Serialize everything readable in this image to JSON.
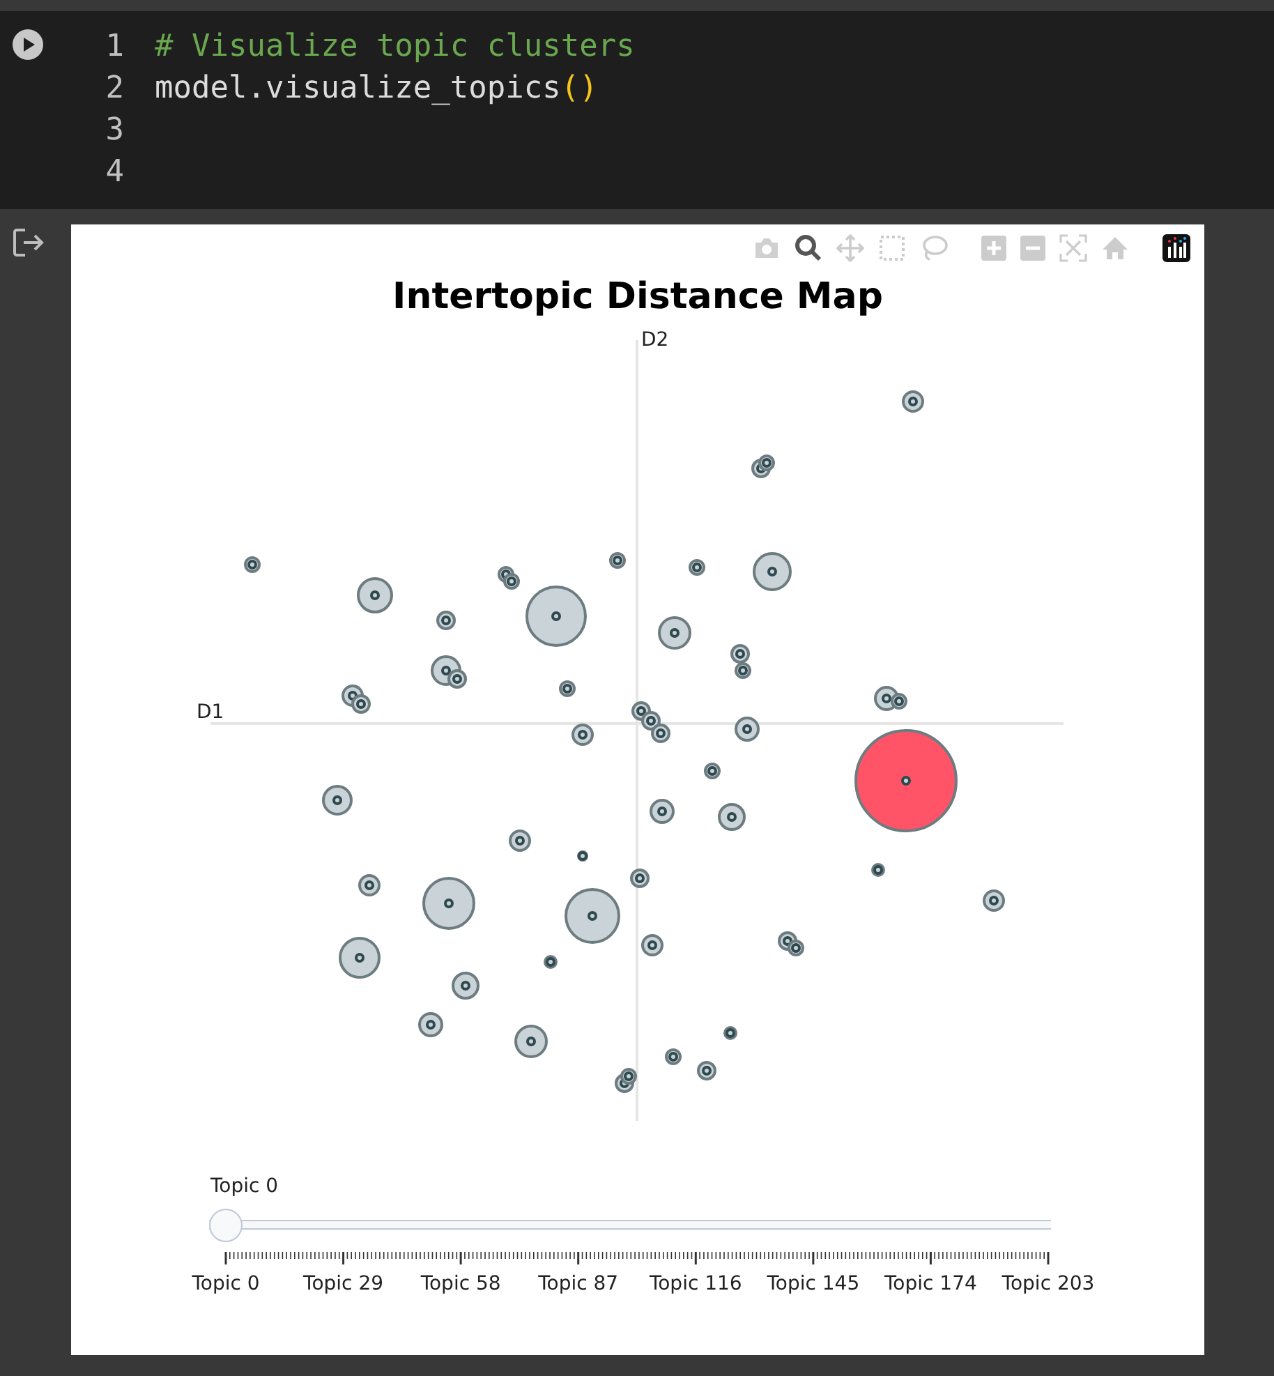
{
  "code_cell": {
    "lines": [
      {
        "number": "1",
        "kind": "comment",
        "text": "# Visualize topic clusters"
      },
      {
        "number": "2",
        "kind": "call",
        "text": "model.visualize_topics",
        "parens": "()"
      },
      {
        "number": "3",
        "kind": "blank"
      },
      {
        "number": "4",
        "kind": "blank"
      }
    ]
  },
  "chart": {
    "title": "Intertopic Distance Map",
    "x_axis_label": "D1",
    "y_axis_label": "D2",
    "slider": {
      "current_label": "Topic 0",
      "level": 0,
      "tick_labels": [
        "Topic 0",
        "Topic 29",
        "Topic 58",
        "Topic 87",
        "Topic 116",
        "Topic 145",
        "Topic 174",
        "Topic 203"
      ]
    }
  }
}
